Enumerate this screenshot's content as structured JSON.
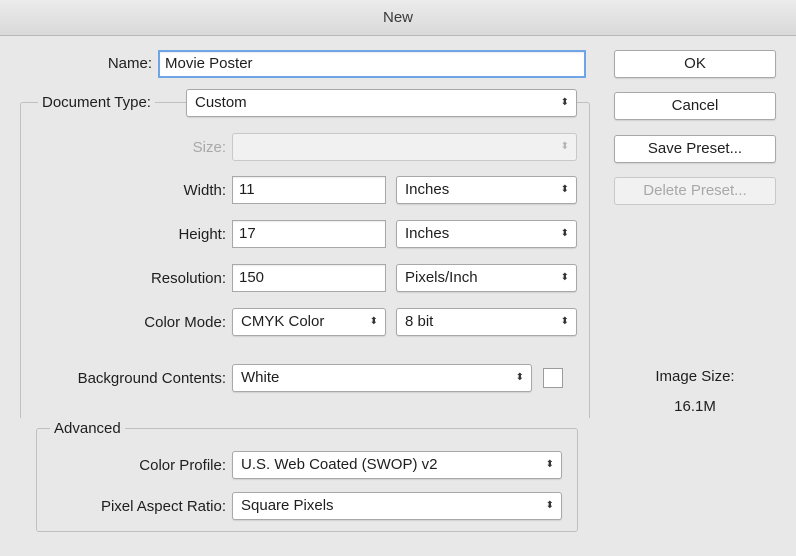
{
  "window": {
    "title": "New"
  },
  "fields": {
    "name_label": "Name:",
    "name_value": "Movie Poster",
    "document_type_label": "Document Type:",
    "document_type_value": "Custom",
    "size_label": "Size:",
    "size_value": "",
    "width_label": "Width:",
    "width_value": "11",
    "width_unit": "Inches",
    "height_label": "Height:",
    "height_value": "17",
    "height_unit": "Inches",
    "resolution_label": "Resolution:",
    "resolution_value": "150",
    "resolution_unit": "Pixels/Inch",
    "color_mode_label": "Color Mode:",
    "color_mode_value": "CMYK Color",
    "bit_depth_value": "8 bit",
    "background_label": "Background Contents:",
    "background_value": "White",
    "background_swatch_color": "#ffffff"
  },
  "advanced": {
    "title": "Advanced",
    "color_profile_label": "Color Profile:",
    "color_profile_value": "U.S. Web Coated (SWOP) v2",
    "pixel_aspect_label": "Pixel Aspect Ratio:",
    "pixel_aspect_value": "Square Pixels"
  },
  "buttons": {
    "ok": "OK",
    "cancel": "Cancel",
    "save_preset": "Save Preset...",
    "delete_preset": "Delete Preset..."
  },
  "info": {
    "image_size_label": "Image Size:",
    "image_size_value": "16.1M"
  },
  "icons": {
    "select_arrows": "⬍"
  }
}
